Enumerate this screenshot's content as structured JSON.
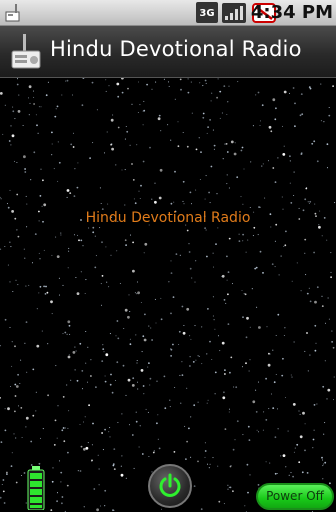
{
  "status_bar": {
    "network_type": "3G",
    "time": "4:34 PM"
  },
  "app_bar": {
    "title": "Hindu Devotional Radio",
    "icon": "radio-icon"
  },
  "main": {
    "label": "Hindu Devotional Radio",
    "label_color": "#e07b1a"
  },
  "controls": {
    "power_off_label": "Power Off",
    "power_icon": "power-icon",
    "battery_icon": "battery-icon",
    "accent_color": "#22cc22"
  }
}
